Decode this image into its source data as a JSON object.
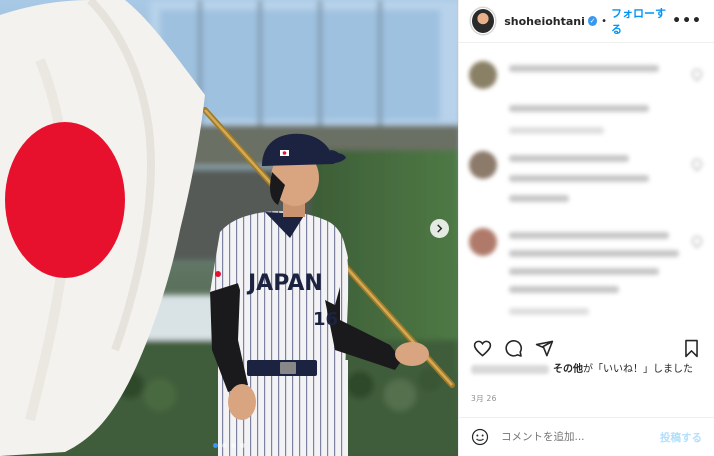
{
  "photo": {
    "description_icons": [
      "japan-flag",
      "baseball-player"
    ],
    "jersey_text": "JAPAN",
    "jersey_number": "16",
    "carousel_dots": 4,
    "active_dot": 1
  },
  "header": {
    "username": "shoheiohtani",
    "separator": "•",
    "follow_label": "フォローする",
    "more_label": "•••"
  },
  "actions": {
    "icons": [
      "heart-icon",
      "comment-icon",
      "share-icon",
      "bookmark-icon"
    ]
  },
  "likes": {
    "others_label": "その他",
    "suffix": "が「いいね！」しました"
  },
  "date": "3月 26",
  "add_comment": {
    "placeholder": "コメントを追加...",
    "post_label": "投稿する"
  },
  "colors": {
    "accent": "#0095f6",
    "flag_red": "#e8112d",
    "cap_navy": "#1c2340",
    "post_disabled": "#b2dffc"
  }
}
